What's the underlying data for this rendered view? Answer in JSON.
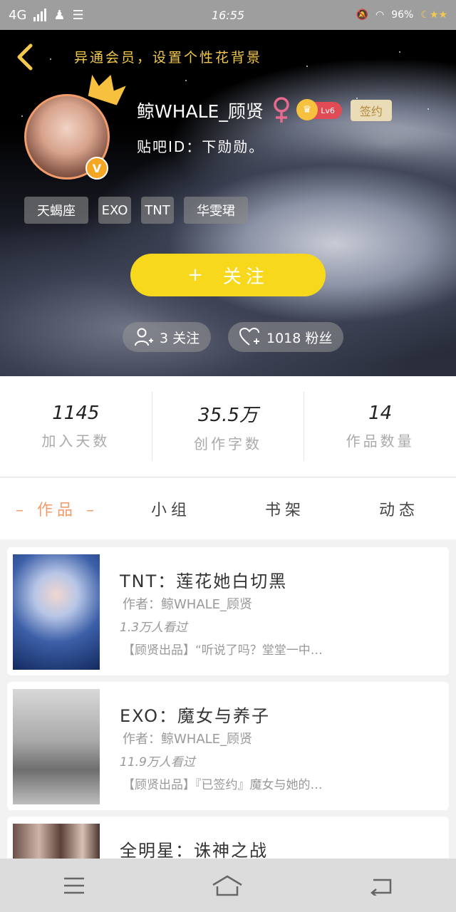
{
  "status_bar": {
    "network": "4G",
    "time": "16:55",
    "battery": "96%"
  },
  "header": {
    "hint": "异通会员，设置个性花背景"
  },
  "profile": {
    "username": "鲸WHALE_顾贤",
    "level": "Lv6",
    "signed_badge": "签约",
    "tieba_id": "贴吧ID：下勋勋。",
    "tags": [
      "天蝎座",
      "EXO",
      "TNT",
      "华雯珺"
    ]
  },
  "actions": {
    "follow_label": "关注",
    "follow_plus": "+",
    "following_label": "3 关注",
    "fans_label": "1018 粉丝"
  },
  "stats": [
    {
      "value": "1145",
      "label": "加入天数"
    },
    {
      "value": "35.5万",
      "label": "创作字数"
    },
    {
      "value": "14",
      "label": "作品数量"
    }
  ],
  "tabs": [
    {
      "label": "– 作品 –"
    },
    {
      "label": "小组"
    },
    {
      "label": "书架"
    },
    {
      "label": "动态"
    }
  ],
  "works": [
    {
      "title": "TNT：莲花她白切黑",
      "author": "作者：鲸WHALE_顾贤",
      "views": "1.3万人看过",
      "desc": "【顾贤出品】“听说了吗？堂堂一中…"
    },
    {
      "title": "EXO：魔女与养子",
      "author": "作者：鲸WHALE_顾贤",
      "views": "11.9万人看过",
      "desc": "【顾贤出品】『已签约』魔女与她的…"
    },
    {
      "title": "全明星：诛神之战",
      "author": "",
      "views": "",
      "desc": ""
    }
  ],
  "colors": {
    "accent_yellow": "#f8d81c",
    "accent_orange": "#f39c6b",
    "hint_gold": "#f2c94c",
    "level_red": "#e04b55"
  },
  "icons": [
    "back-arrow-icon",
    "crown-icon",
    "female-icon",
    "user-plus-icon",
    "heart-plus-icon",
    "menu-icon",
    "home-icon",
    "back-icon"
  ]
}
